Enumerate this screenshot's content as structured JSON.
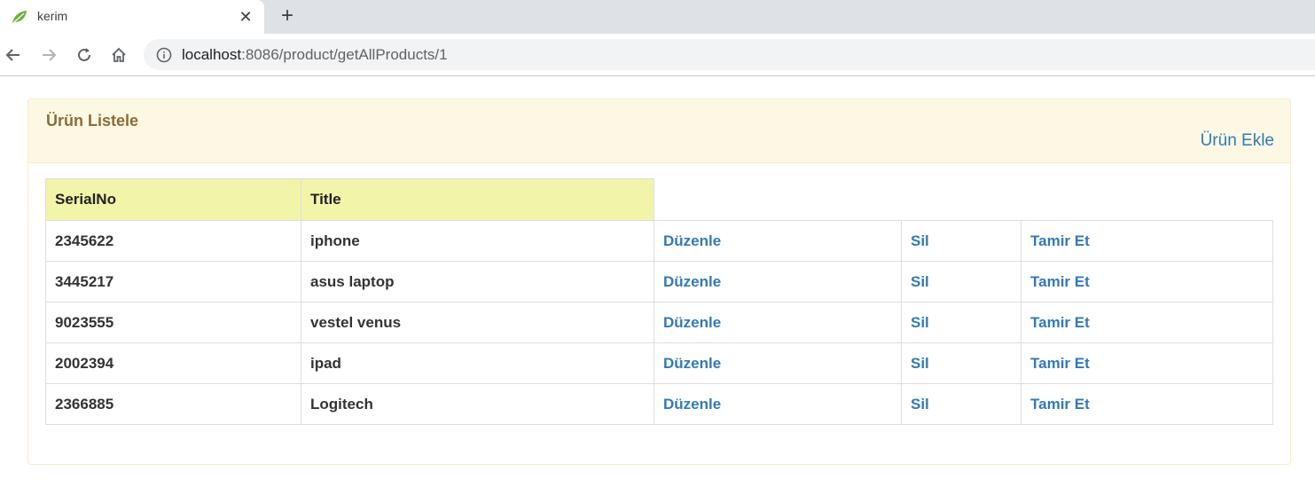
{
  "browser": {
    "tab_title": "kerim",
    "url_host": "localhost",
    "url_path": ":8086/product/getAllProducts/1"
  },
  "panel": {
    "title": "Ürün Listele",
    "add_link": "Ürün Ekle"
  },
  "table": {
    "headers": [
      "SerialNo",
      "Title"
    ],
    "rows": [
      {
        "serial": "2345622",
        "title": "iphone",
        "edit": "Düzenle",
        "delete": "Sil",
        "repair": "Tamir Et"
      },
      {
        "serial": "3445217",
        "title": "asus laptop",
        "edit": "Düzenle",
        "delete": "Sil",
        "repair": "Tamir Et"
      },
      {
        "serial": "9023555",
        "title": "vestel venus",
        "edit": "Düzenle",
        "delete": "Sil",
        "repair": "Tamir Et"
      },
      {
        "serial": "2002394",
        "title": "ipad",
        "edit": "Düzenle",
        "delete": "Sil",
        "repair": "Tamir Et"
      },
      {
        "serial": "2366885",
        "title": "Logitech",
        "edit": "Düzenle",
        "delete": "Sil",
        "repair": "Tamir Et"
      }
    ]
  },
  "colors": {
    "link": "#337ab7",
    "heading_bg": "#fcf8e3",
    "heading_text": "#8a6d3b",
    "table_header_bg": "#f2f5a9"
  },
  "icons": {
    "favicon": "spring-leaf-icon",
    "back": "arrow-left-icon",
    "forward": "arrow-right-icon",
    "reload": "reload-icon",
    "home": "home-icon",
    "info": "info-icon",
    "close": "close-icon",
    "new_tab": "plus-icon"
  }
}
